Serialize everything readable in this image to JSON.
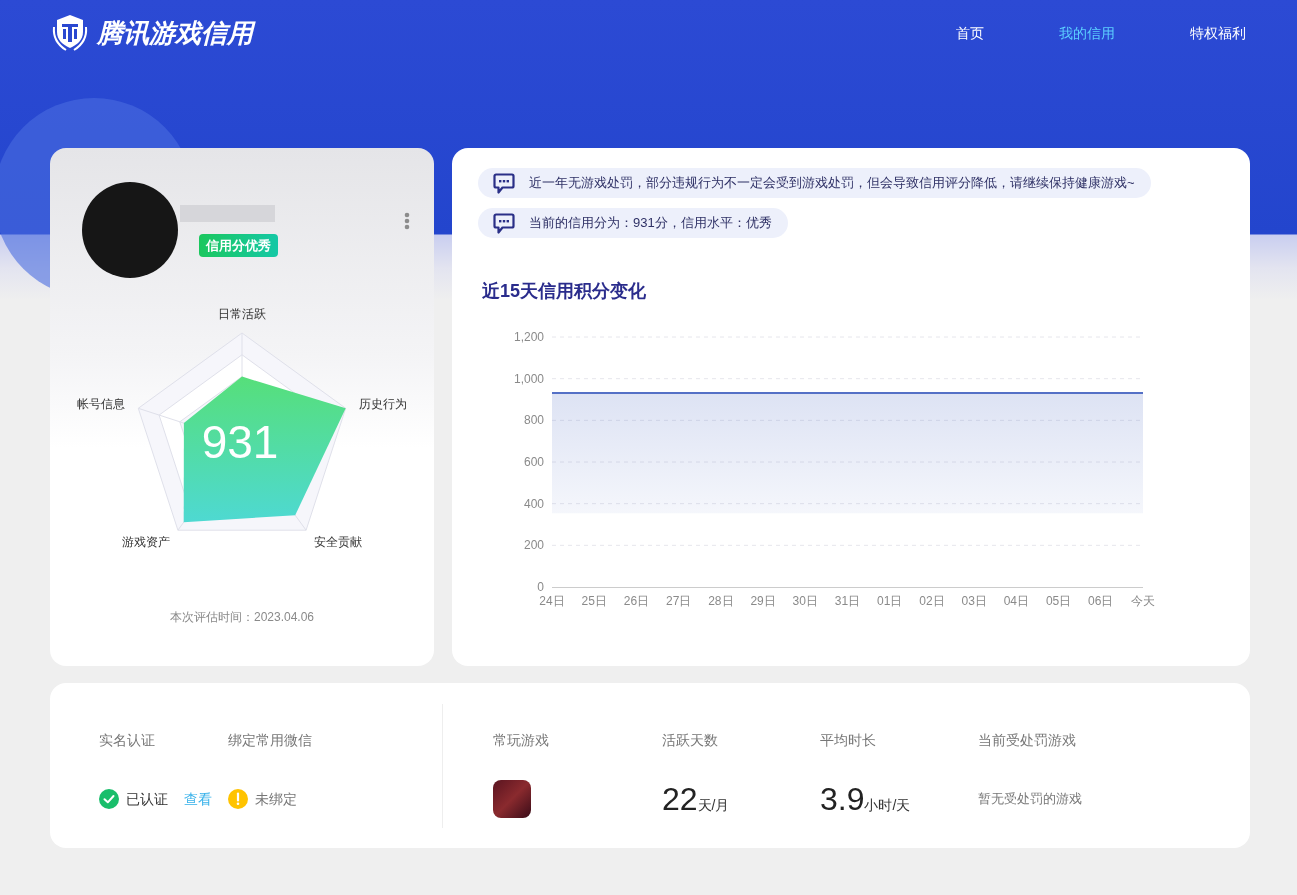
{
  "header": {
    "logo_text": "腾讯游戏信用",
    "nav": [
      {
        "label": "首页",
        "selected": false
      },
      {
        "label": "我的信用",
        "selected": true
      },
      {
        "label": "特权福利",
        "selected": false
      }
    ]
  },
  "profile_card": {
    "badge": "信用分优秀",
    "radar_axes": [
      "日常活跃",
      "历史行为",
      "安全贡献",
      "游戏资产",
      "帐号信息"
    ],
    "score": "931",
    "evaluation_time": "本次评估时间：2023.04.06"
  },
  "credit_overview": {
    "messages": [
      "近一年无游戏处罚，部分违规行为不一定会受到游戏处罚，但会导致信用评分降低，请继续保持健康游戏~",
      "当前的信用分为：931分，信用水平：优秀"
    ],
    "chart_title": "近15天信用积分变化",
    "chart_data": {
      "type": "area",
      "grid": true,
      "categories": [
        "24日",
        "25日",
        "26日",
        "27日",
        "28日",
        "29日",
        "30日",
        "31日",
        "01日",
        "02日",
        "03日",
        "04日",
        "05日",
        "06日",
        "今天"
      ],
      "series": [
        {
          "color": "#5470c6",
          "values": [
            931,
            931,
            931,
            931,
            931,
            931,
            931,
            931,
            931,
            931,
            931,
            931,
            931,
            931,
            931
          ]
        }
      ],
      "ylim": [
        0,
        1200
      ],
      "yticks": [
        0,
        200,
        400,
        600,
        800,
        {
          "value": 1000,
          "label": "1,000"
        },
        {
          "value": 1200,
          "label": "1,200"
        }
      ]
    }
  },
  "summary": {
    "account": [
      {
        "label": "实名认证",
        "kind": "verified",
        "status": "已认证",
        "link": "查看"
      },
      {
        "label": "绑定常用微信",
        "kind": "unbound",
        "status": "未绑定"
      }
    ],
    "stats": [
      {
        "label": "常玩游戏",
        "kind": "game"
      },
      {
        "label": "活跃天数",
        "kind": "number",
        "value": "22",
        "unit": "天/月"
      },
      {
        "label": "平均时长",
        "kind": "number",
        "value": "3.9",
        "unit": "小时/天"
      },
      {
        "label": "当前受处罚游戏",
        "kind": "text",
        "value": "暂无受处罚的游戏"
      }
    ]
  }
}
